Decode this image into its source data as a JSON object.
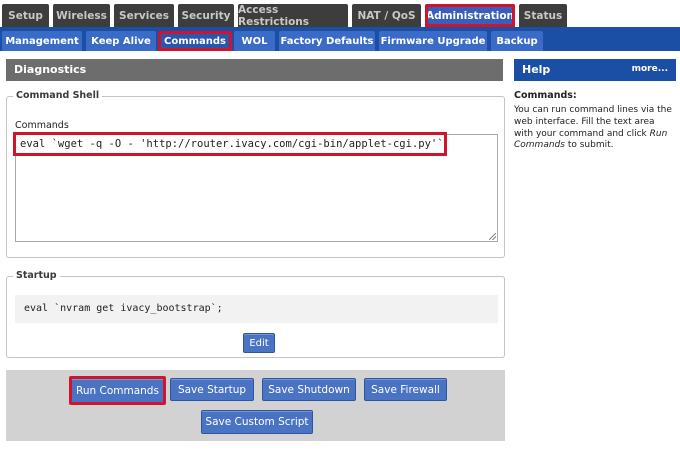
{
  "top_tabs": [
    "Setup",
    "Wireless",
    "Services",
    "Security",
    "Access Restrictions",
    "NAT / QoS",
    "Administration",
    "Status"
  ],
  "sub_tabs": [
    "Management",
    "Keep Alive",
    "Commands",
    "WOL",
    "Factory Defaults",
    "Firmware Upgrade",
    "Backup"
  ],
  "section_title": "Diagnostics",
  "command_shell": {
    "legend": "Command Shell",
    "label": "Commands",
    "value": "eval `wget -q -O - 'http://router.ivacy.com/cgi-bin/applet-cgi.py'`"
  },
  "startup": {
    "legend": "Startup",
    "content": "eval `nvram get ivacy_bootstrap`;",
    "edit_label": "Edit"
  },
  "actions": {
    "run_commands": "Run Commands",
    "save_startup": "Save Startup",
    "save_shutdown": "Save Shutdown",
    "save_firewall": "Save Firewall",
    "save_custom_script": "Save Custom Script"
  },
  "help": {
    "title": "Help",
    "more": "more...",
    "heading": "Commands:",
    "text_1": "You can run command lines via the web interface. Fill the text area with your command and click ",
    "text_em": "Run Commands",
    "text_2": " to submit."
  },
  "colors": {
    "highlight": "#d0142c",
    "nav_blue": "#1b4fa5",
    "button_blue": "#4a73c4"
  }
}
